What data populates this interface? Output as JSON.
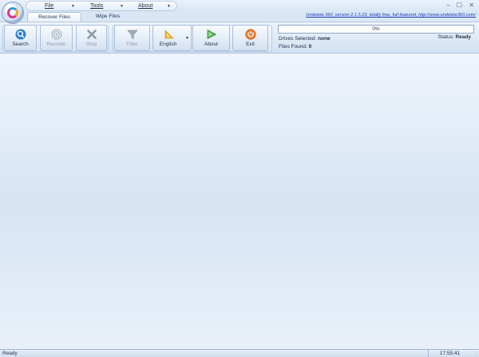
{
  "menu": {
    "items": [
      {
        "label": "File"
      },
      {
        "label": "Tools"
      },
      {
        "label": "About"
      }
    ]
  },
  "window_controls": "– ☐ ✕",
  "tabs": [
    {
      "label": "Recover Files",
      "active": true
    },
    {
      "label": "Wipe Files",
      "active": false
    }
  ],
  "version_text": "Undelete 360, version 2.1.5.23, totally free, full-featured, http://www.undelete360.com/",
  "ribbon": {
    "buttons": [
      {
        "label": "Search",
        "icon": "search-icon",
        "enabled": true
      },
      {
        "label": "Recover",
        "icon": "recover-icon",
        "enabled": false
      },
      {
        "label": "Stop",
        "icon": "stop-icon",
        "enabled": false
      },
      {
        "label": "Filter",
        "icon": "filter-icon",
        "enabled": false
      },
      {
        "label": "English",
        "icon": "language-icon",
        "enabled": true
      },
      {
        "label": "About",
        "icon": "about-icon",
        "enabled": true
      },
      {
        "label": "Exit",
        "icon": "exit-icon",
        "enabled": true
      }
    ]
  },
  "progress": {
    "percent_text": "0%",
    "value": 0
  },
  "info": {
    "drives_label": "Drives Selected:",
    "drives_value": "none",
    "files_label": "Files Found:",
    "files_value": "0",
    "status_label": "Status:",
    "status_value": "Ready"
  },
  "statusbar": {
    "left_text": "Ready",
    "time": "17:55:41"
  },
  "colors": {
    "accent": "#1b39b8",
    "progress": "#4fae4f"
  }
}
